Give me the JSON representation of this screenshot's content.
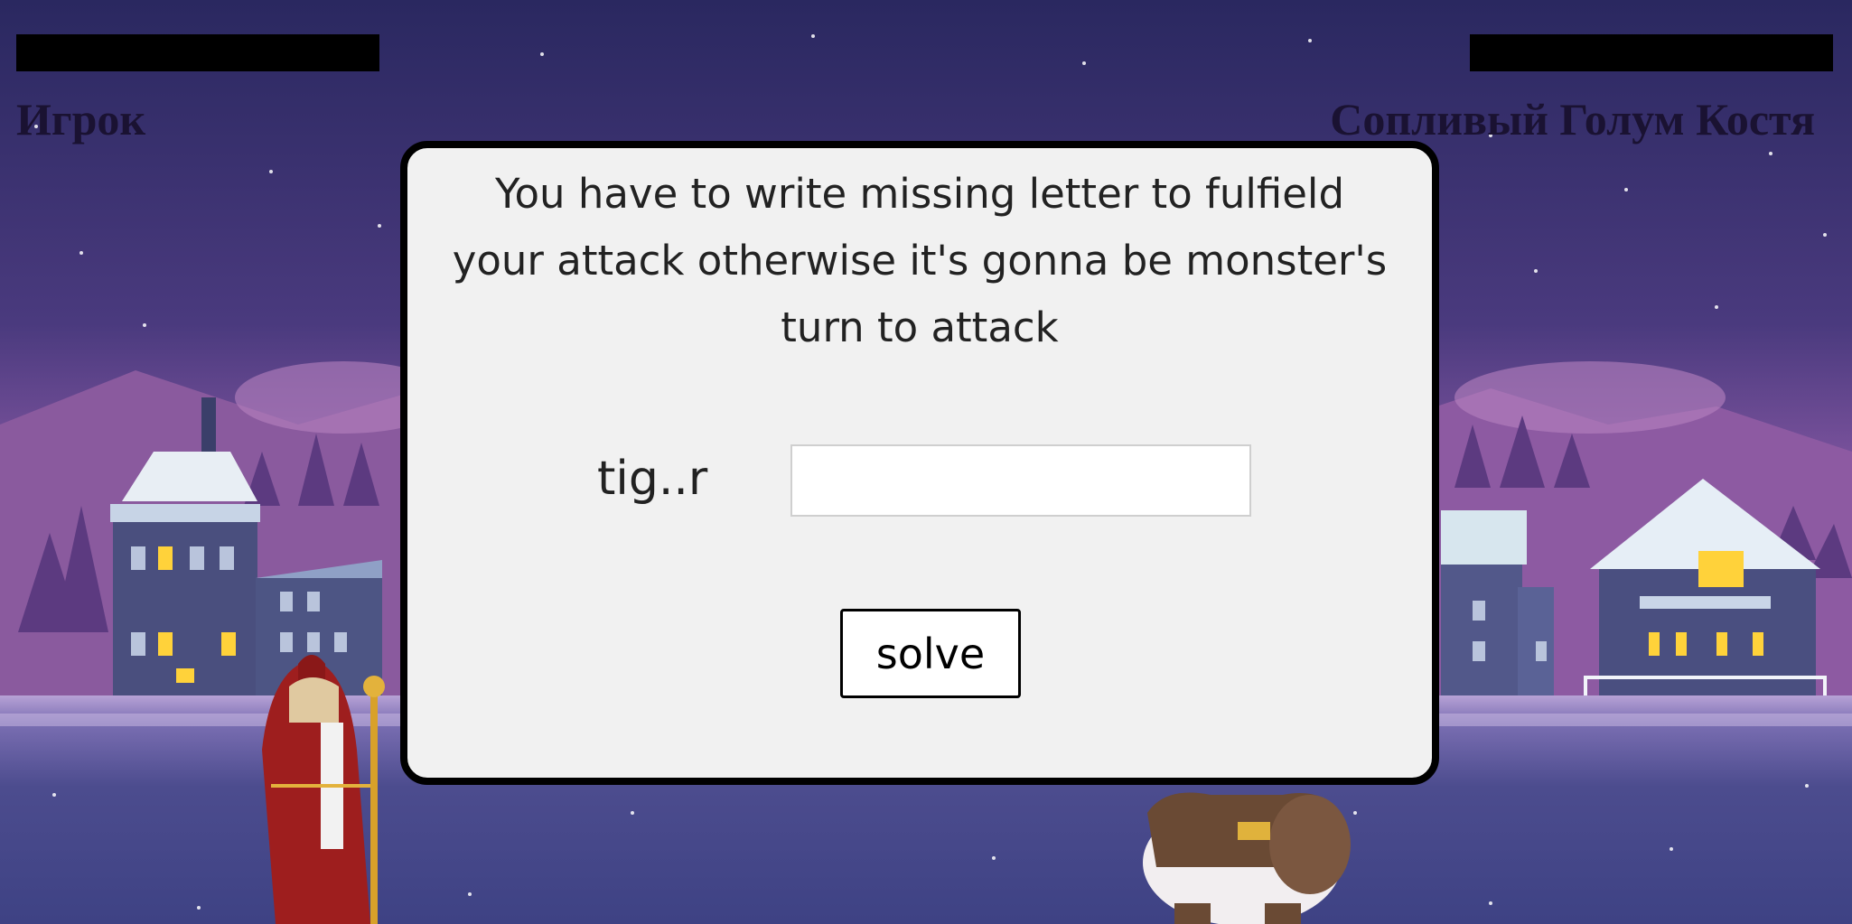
{
  "player": {
    "name": "Игрок",
    "hp_fraction": 1.0
  },
  "monster": {
    "name": "Сопливый Голум Костя",
    "hp_fraction": 1.0
  },
  "dialog": {
    "prompt": "You have to write missing letter to fulfield your attack otherwise it's gonna be monster's turn to attack",
    "word": "tig..r",
    "answer_value": "",
    "solve_label": "solve"
  },
  "colors": {
    "sky_top": "#2a2860",
    "sky_mid": "#6a4c96",
    "horizon": "#d17fb4",
    "snow_ground": "#4a4a8a",
    "hp_bar": "#000000"
  },
  "icons": {
    "player_sprite": "wizard-icon",
    "monster_sprite": "golem-icon"
  }
}
